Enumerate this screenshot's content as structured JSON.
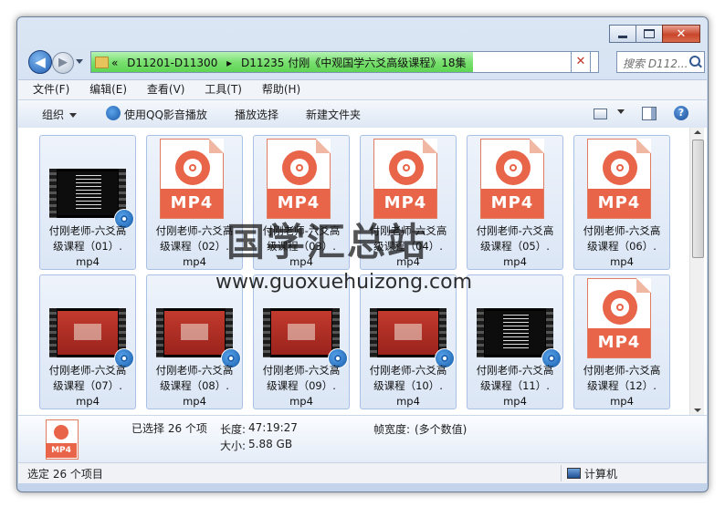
{
  "window": {
    "minimize": "",
    "maximize": "",
    "close": "✕"
  },
  "address": {
    "overflow": "«",
    "crumbs": [
      "D11201-D11300",
      "▸",
      "D11235 付刚《中观国学六爻高级课程》18集"
    ],
    "refresh": "✕"
  },
  "search": {
    "placeholder": "搜索 D112..."
  },
  "menu": [
    "文件(F)",
    "编辑(E)",
    "查看(V)",
    "工具(T)",
    "帮助(H)"
  ],
  "toolbar": {
    "organize": "组织",
    "play_qq": "使用QQ影音播放",
    "play_selected": "播放选择",
    "new_folder": "新建文件夹",
    "help": "?"
  },
  "files": [
    {
      "l1": "付刚老师-六爻高",
      "l2": "级课程（01）.",
      "l3": "mp4",
      "thumb": "dark"
    },
    {
      "l1": "付刚老师-六爻高",
      "l2": "级课程（02）.",
      "l3": "mp4",
      "thumb": "icon"
    },
    {
      "l1": "付刚老师-六爻高",
      "l2": "级课程（03）.",
      "l3": "mp4",
      "thumb": "icon"
    },
    {
      "l1": "付刚老师-六爻高",
      "l2": "级课程（04）.",
      "l3": "mp4",
      "thumb": "icon"
    },
    {
      "l1": "付刚老师-六爻高",
      "l2": "级课程（05）.",
      "l3": "mp4",
      "thumb": "icon"
    },
    {
      "l1": "付刚老师-六爻高",
      "l2": "级课程（06）.",
      "l3": "mp4",
      "thumb": "icon"
    },
    {
      "l1": "付刚老师-六爻高",
      "l2": "级课程（07）.",
      "l3": "mp4",
      "thumb": "red"
    },
    {
      "l1": "付刚老师-六爻高",
      "l2": "级课程（08）.",
      "l3": "mp4",
      "thumb": "red"
    },
    {
      "l1": "付刚老师-六爻高",
      "l2": "级课程（09）.",
      "l3": "mp4",
      "thumb": "red"
    },
    {
      "l1": "付刚老师-六爻高",
      "l2": "级课程（10）.",
      "l3": "mp4",
      "thumb": "red"
    },
    {
      "l1": "付刚老师-六爻高",
      "l2": "级课程（11）.",
      "l3": "mp4",
      "thumb": "dark"
    },
    {
      "l1": "付刚老师-六爻高",
      "l2": "级课程（12）.",
      "l3": "mp4",
      "thumb": "icon"
    }
  ],
  "icon_text": "MP4",
  "details": {
    "selected": "已选择 26 个项",
    "length_label": "长度:",
    "length_value": "47:19:27",
    "size_label": "大小:",
    "size_value": "5.88 GB",
    "width_label": "帧宽度:",
    "width_value": "(多个数值)",
    "icon_text": "MP4"
  },
  "status": {
    "left": "选定 26 个项目",
    "right": "计算机"
  },
  "watermark": {
    "title": "国学汇总站",
    "url": "www.guoxuehuizong.com"
  }
}
